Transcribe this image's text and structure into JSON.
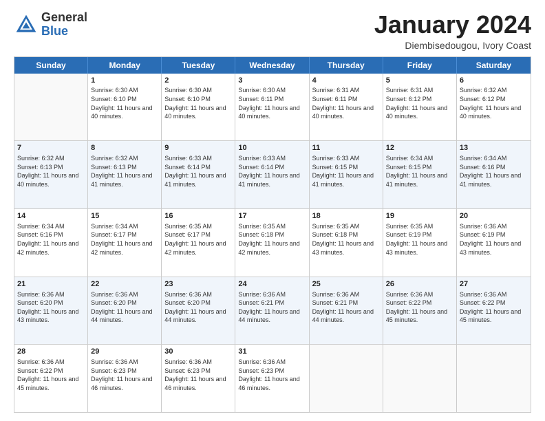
{
  "header": {
    "logo_general": "General",
    "logo_blue": "Blue",
    "month_title": "January 2024",
    "location": "Diembisedougou, Ivory Coast"
  },
  "weekdays": [
    "Sunday",
    "Monday",
    "Tuesday",
    "Wednesday",
    "Thursday",
    "Friday",
    "Saturday"
  ],
  "rows": [
    [
      {
        "day": "",
        "sunrise": "",
        "sunset": "",
        "daylight": ""
      },
      {
        "day": "1",
        "sunrise": "Sunrise: 6:30 AM",
        "sunset": "Sunset: 6:10 PM",
        "daylight": "Daylight: 11 hours and 40 minutes."
      },
      {
        "day": "2",
        "sunrise": "Sunrise: 6:30 AM",
        "sunset": "Sunset: 6:10 PM",
        "daylight": "Daylight: 11 hours and 40 minutes."
      },
      {
        "day": "3",
        "sunrise": "Sunrise: 6:30 AM",
        "sunset": "Sunset: 6:11 PM",
        "daylight": "Daylight: 11 hours and 40 minutes."
      },
      {
        "day": "4",
        "sunrise": "Sunrise: 6:31 AM",
        "sunset": "Sunset: 6:11 PM",
        "daylight": "Daylight: 11 hours and 40 minutes."
      },
      {
        "day": "5",
        "sunrise": "Sunrise: 6:31 AM",
        "sunset": "Sunset: 6:12 PM",
        "daylight": "Daylight: 11 hours and 40 minutes."
      },
      {
        "day": "6",
        "sunrise": "Sunrise: 6:32 AM",
        "sunset": "Sunset: 6:12 PM",
        "daylight": "Daylight: 11 hours and 40 minutes."
      }
    ],
    [
      {
        "day": "7",
        "sunrise": "Sunrise: 6:32 AM",
        "sunset": "Sunset: 6:13 PM",
        "daylight": "Daylight: 11 hours and 40 minutes."
      },
      {
        "day": "8",
        "sunrise": "Sunrise: 6:32 AM",
        "sunset": "Sunset: 6:13 PM",
        "daylight": "Daylight: 11 hours and 41 minutes."
      },
      {
        "day": "9",
        "sunrise": "Sunrise: 6:33 AM",
        "sunset": "Sunset: 6:14 PM",
        "daylight": "Daylight: 11 hours and 41 minutes."
      },
      {
        "day": "10",
        "sunrise": "Sunrise: 6:33 AM",
        "sunset": "Sunset: 6:14 PM",
        "daylight": "Daylight: 11 hours and 41 minutes."
      },
      {
        "day": "11",
        "sunrise": "Sunrise: 6:33 AM",
        "sunset": "Sunset: 6:15 PM",
        "daylight": "Daylight: 11 hours and 41 minutes."
      },
      {
        "day": "12",
        "sunrise": "Sunrise: 6:34 AM",
        "sunset": "Sunset: 6:15 PM",
        "daylight": "Daylight: 11 hours and 41 minutes."
      },
      {
        "day": "13",
        "sunrise": "Sunrise: 6:34 AM",
        "sunset": "Sunset: 6:16 PM",
        "daylight": "Daylight: 11 hours and 41 minutes."
      }
    ],
    [
      {
        "day": "14",
        "sunrise": "Sunrise: 6:34 AM",
        "sunset": "Sunset: 6:16 PM",
        "daylight": "Daylight: 11 hours and 42 minutes."
      },
      {
        "day": "15",
        "sunrise": "Sunrise: 6:34 AM",
        "sunset": "Sunset: 6:17 PM",
        "daylight": "Daylight: 11 hours and 42 minutes."
      },
      {
        "day": "16",
        "sunrise": "Sunrise: 6:35 AM",
        "sunset": "Sunset: 6:17 PM",
        "daylight": "Daylight: 11 hours and 42 minutes."
      },
      {
        "day": "17",
        "sunrise": "Sunrise: 6:35 AM",
        "sunset": "Sunset: 6:18 PM",
        "daylight": "Daylight: 11 hours and 42 minutes."
      },
      {
        "day": "18",
        "sunrise": "Sunrise: 6:35 AM",
        "sunset": "Sunset: 6:18 PM",
        "daylight": "Daylight: 11 hours and 43 minutes."
      },
      {
        "day": "19",
        "sunrise": "Sunrise: 6:35 AM",
        "sunset": "Sunset: 6:19 PM",
        "daylight": "Daylight: 11 hours and 43 minutes."
      },
      {
        "day": "20",
        "sunrise": "Sunrise: 6:36 AM",
        "sunset": "Sunset: 6:19 PM",
        "daylight": "Daylight: 11 hours and 43 minutes."
      }
    ],
    [
      {
        "day": "21",
        "sunrise": "Sunrise: 6:36 AM",
        "sunset": "Sunset: 6:20 PM",
        "daylight": "Daylight: 11 hours and 43 minutes."
      },
      {
        "day": "22",
        "sunrise": "Sunrise: 6:36 AM",
        "sunset": "Sunset: 6:20 PM",
        "daylight": "Daylight: 11 hours and 44 minutes."
      },
      {
        "day": "23",
        "sunrise": "Sunrise: 6:36 AM",
        "sunset": "Sunset: 6:20 PM",
        "daylight": "Daylight: 11 hours and 44 minutes."
      },
      {
        "day": "24",
        "sunrise": "Sunrise: 6:36 AM",
        "sunset": "Sunset: 6:21 PM",
        "daylight": "Daylight: 11 hours and 44 minutes."
      },
      {
        "day": "25",
        "sunrise": "Sunrise: 6:36 AM",
        "sunset": "Sunset: 6:21 PM",
        "daylight": "Daylight: 11 hours and 44 minutes."
      },
      {
        "day": "26",
        "sunrise": "Sunrise: 6:36 AM",
        "sunset": "Sunset: 6:22 PM",
        "daylight": "Daylight: 11 hours and 45 minutes."
      },
      {
        "day": "27",
        "sunrise": "Sunrise: 6:36 AM",
        "sunset": "Sunset: 6:22 PM",
        "daylight": "Daylight: 11 hours and 45 minutes."
      }
    ],
    [
      {
        "day": "28",
        "sunrise": "Sunrise: 6:36 AM",
        "sunset": "Sunset: 6:22 PM",
        "daylight": "Daylight: 11 hours and 45 minutes."
      },
      {
        "day": "29",
        "sunrise": "Sunrise: 6:36 AM",
        "sunset": "Sunset: 6:23 PM",
        "daylight": "Daylight: 11 hours and 46 minutes."
      },
      {
        "day": "30",
        "sunrise": "Sunrise: 6:36 AM",
        "sunset": "Sunset: 6:23 PM",
        "daylight": "Daylight: 11 hours and 46 minutes."
      },
      {
        "day": "31",
        "sunrise": "Sunrise: 6:36 AM",
        "sunset": "Sunset: 6:23 PM",
        "daylight": "Daylight: 11 hours and 46 minutes."
      },
      {
        "day": "",
        "sunrise": "",
        "sunset": "",
        "daylight": ""
      },
      {
        "day": "",
        "sunrise": "",
        "sunset": "",
        "daylight": ""
      },
      {
        "day": "",
        "sunrise": "",
        "sunset": "",
        "daylight": ""
      }
    ]
  ]
}
